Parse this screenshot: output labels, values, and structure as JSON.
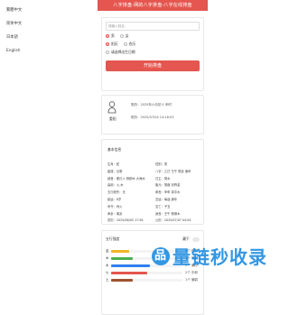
{
  "sidebar": {
    "items": [
      {
        "label": "繁體中文"
      },
      {
        "label": "简体中文"
      },
      {
        "label": "日本語"
      },
      {
        "label": "English"
      }
    ]
  },
  "header": {
    "title": "八字排盘-网的八字排盘-八字在线排盘"
  },
  "form": {
    "name_placeholder": "请输入姓名",
    "gender_male": "男",
    "gender_female": "女",
    "calendar_solar": "阳历",
    "calendar_lunar": "农历",
    "date_select": "请选择出生日期",
    "submit_label": "开始排盘"
  },
  "profile": {
    "name": "重阳",
    "line1": "阴历：2025年六月初十 申时",
    "line2": "阳历：2025/07/04 14:16:03"
  },
  "bazi": {
    "title": "基本信息",
    "rows": [
      [
        "生肖：蛇",
        "性别：男"
      ],
      [
        "星座：巨蟹",
        "八字：乙巳 壬午 癸亥 庚申"
      ],
      [
        "纳音：覆灯火 杨柳木 大海水",
        "日主：癸水"
      ],
      [
        "喜用：火,木",
        "胎元：癸酉 剑锋金"
      ],
      [
        "五行缺失：无",
        "命宫：甲申 泉中水"
      ],
      [
        "起运：8岁",
        "交运：每逢 庚年"
      ],
      [
        "司令：丙火",
        "空亡：子丑"
      ],
      [
        "命卦：离卦",
        "身宫：壬午 杨柳木"
      ],
      [
        "农历：2025/06/05 17:56",
        "公历：2025/07/07 04:04"
      ]
    ]
  },
  "wuxing": {
    "title": "五行强度",
    "toggle_label": "藏干",
    "bars": [
      {
        "label": "金",
        "value_text": "1个 极弱",
        "percent": 25,
        "color": "#f0b429"
      },
      {
        "label": "木",
        "value_text": "1个 偏弱",
        "percent": 30,
        "color": "#4caf50"
      },
      {
        "label": "水",
        "value_text": "2个 偏旺",
        "percent": 55,
        "color": "#2f80ed"
      },
      {
        "label": "火",
        "value_text": "2个 中和",
        "percent": 50,
        "color": "#e4564f"
      },
      {
        "label": "土",
        "value_text": "1个 偏弱",
        "percent": 30,
        "color": "#a0522d"
      }
    ]
  },
  "watermark": {
    "text": "量链秒收录",
    "logo_char": "品"
  }
}
